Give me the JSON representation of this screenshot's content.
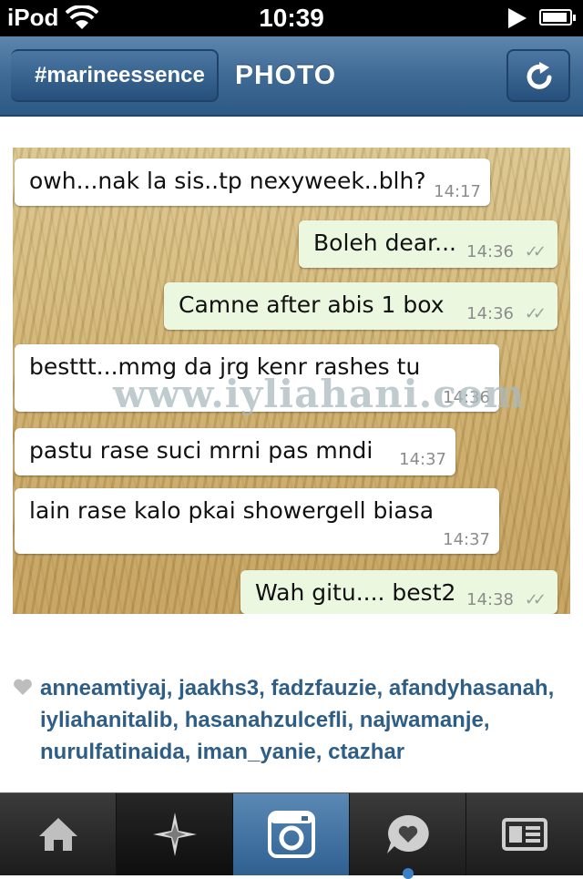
{
  "status_bar": {
    "carrier": "iPod",
    "time": "10:39"
  },
  "nav": {
    "back_label": "#marineessence",
    "title": "PHOTO"
  },
  "photo": {
    "watermark": "www.iyliahani.com",
    "messages": [
      {
        "text": "owh...nak la sis..tp nexyweek..blh?",
        "time": "14:17",
        "direction": "incoming"
      },
      {
        "text": "Boleh dear...",
        "time": "14:36",
        "direction": "outgoing",
        "ticks": "✓✓"
      },
      {
        "text": "Camne after abis 1 box",
        "time": "14:36",
        "direction": "outgoing",
        "ticks": "✓✓"
      },
      {
        "text": "besttt...mmg da jrg kenr rashes tu",
        "time": "14:36",
        "direction": "incoming"
      },
      {
        "text": "pastu rase suci mrni pas mndi",
        "time": "14:37",
        "direction": "incoming"
      },
      {
        "text": "lain rase kalo pkai showergell biasa",
        "time": "14:37",
        "direction": "incoming"
      },
      {
        "text": "Wah gitu.... best2",
        "time": "14:38",
        "direction": "outgoing",
        "ticks": "✓✓"
      }
    ]
  },
  "likes": {
    "users": [
      "anneamtiyaj",
      "jaakhs3",
      "fadzfauzie",
      "afandyhasanah",
      "iyliahanitalib",
      "hasanahzulcefli",
      "najwamanje",
      "nurulfatinaida",
      "iman_yanie",
      "ctazhar"
    ],
    "separator": ", "
  },
  "tabbar": {
    "tabs": [
      {
        "icon": "home-icon",
        "active": false
      },
      {
        "icon": "explore-icon",
        "active": false
      },
      {
        "icon": "camera-icon",
        "active": true
      },
      {
        "icon": "news-icon",
        "active": false
      },
      {
        "icon": "profile-icon",
        "active": false
      }
    ]
  },
  "colors": {
    "nav_blue": "#3f6a94",
    "link_blue": "#2e5e86",
    "active_tab": "#5b89b5"
  }
}
